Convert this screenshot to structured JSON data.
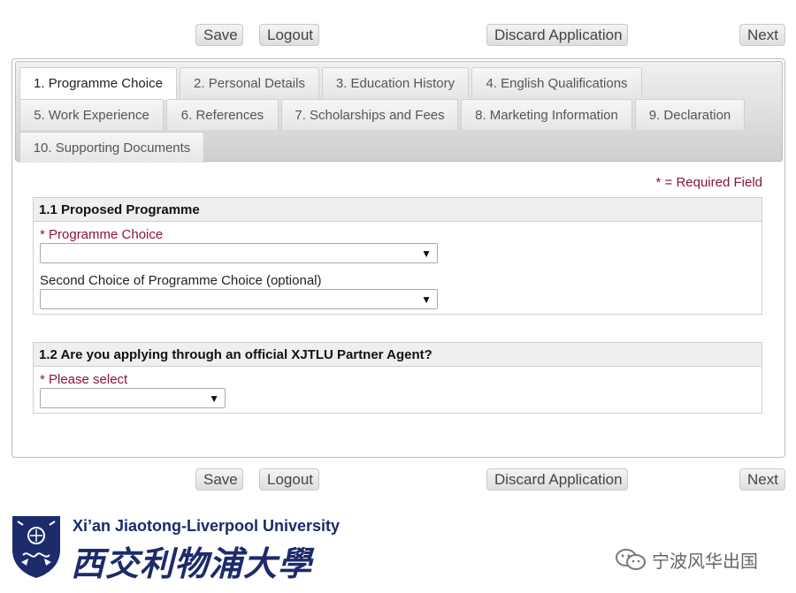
{
  "toolbar": {
    "save_label": "Save",
    "logout_label": "Logout",
    "discard_label": "Discard Application",
    "next_label": "Next"
  },
  "tabs": [
    {
      "label": "1. Programme Choice",
      "active": true
    },
    {
      "label": "2. Personal Details",
      "active": false
    },
    {
      "label": "3. Education History",
      "active": false
    },
    {
      "label": "4. English Qualifications",
      "active": false
    },
    {
      "label": "5. Work Experience",
      "active": false
    },
    {
      "label": "6. References",
      "active": false
    },
    {
      "label": "7. Scholarships and Fees",
      "active": false
    },
    {
      "label": "8. Marketing Information",
      "active": false
    },
    {
      "label": "9. Declaration",
      "active": false
    },
    {
      "label": "10. Supporting Documents",
      "active": false
    }
  ],
  "required_note": "* = Required Field",
  "section1": {
    "title": "1.1 Proposed Programme",
    "choice_label": "* Programme Choice",
    "choice_value": "",
    "second_label": "Second Choice of Programme Choice (optional)",
    "second_value": ""
  },
  "section2": {
    "title": "1.2 Are you applying through an official XJTLU Partner Agent?",
    "select_label": "* Please select",
    "select_value": ""
  },
  "footer": {
    "university_en": "Xi’an Jiaotong-Liverpool University",
    "university_cn": "西交利物浦大學",
    "watermark": "宁波风华出国"
  },
  "colors": {
    "required": "#8a1538",
    "brand": "#1d2a6b"
  },
  "icons": {
    "dropdown": "dropdown-arrow-icon",
    "crest": "university-crest-icon",
    "wechat": "wechat-icon"
  }
}
